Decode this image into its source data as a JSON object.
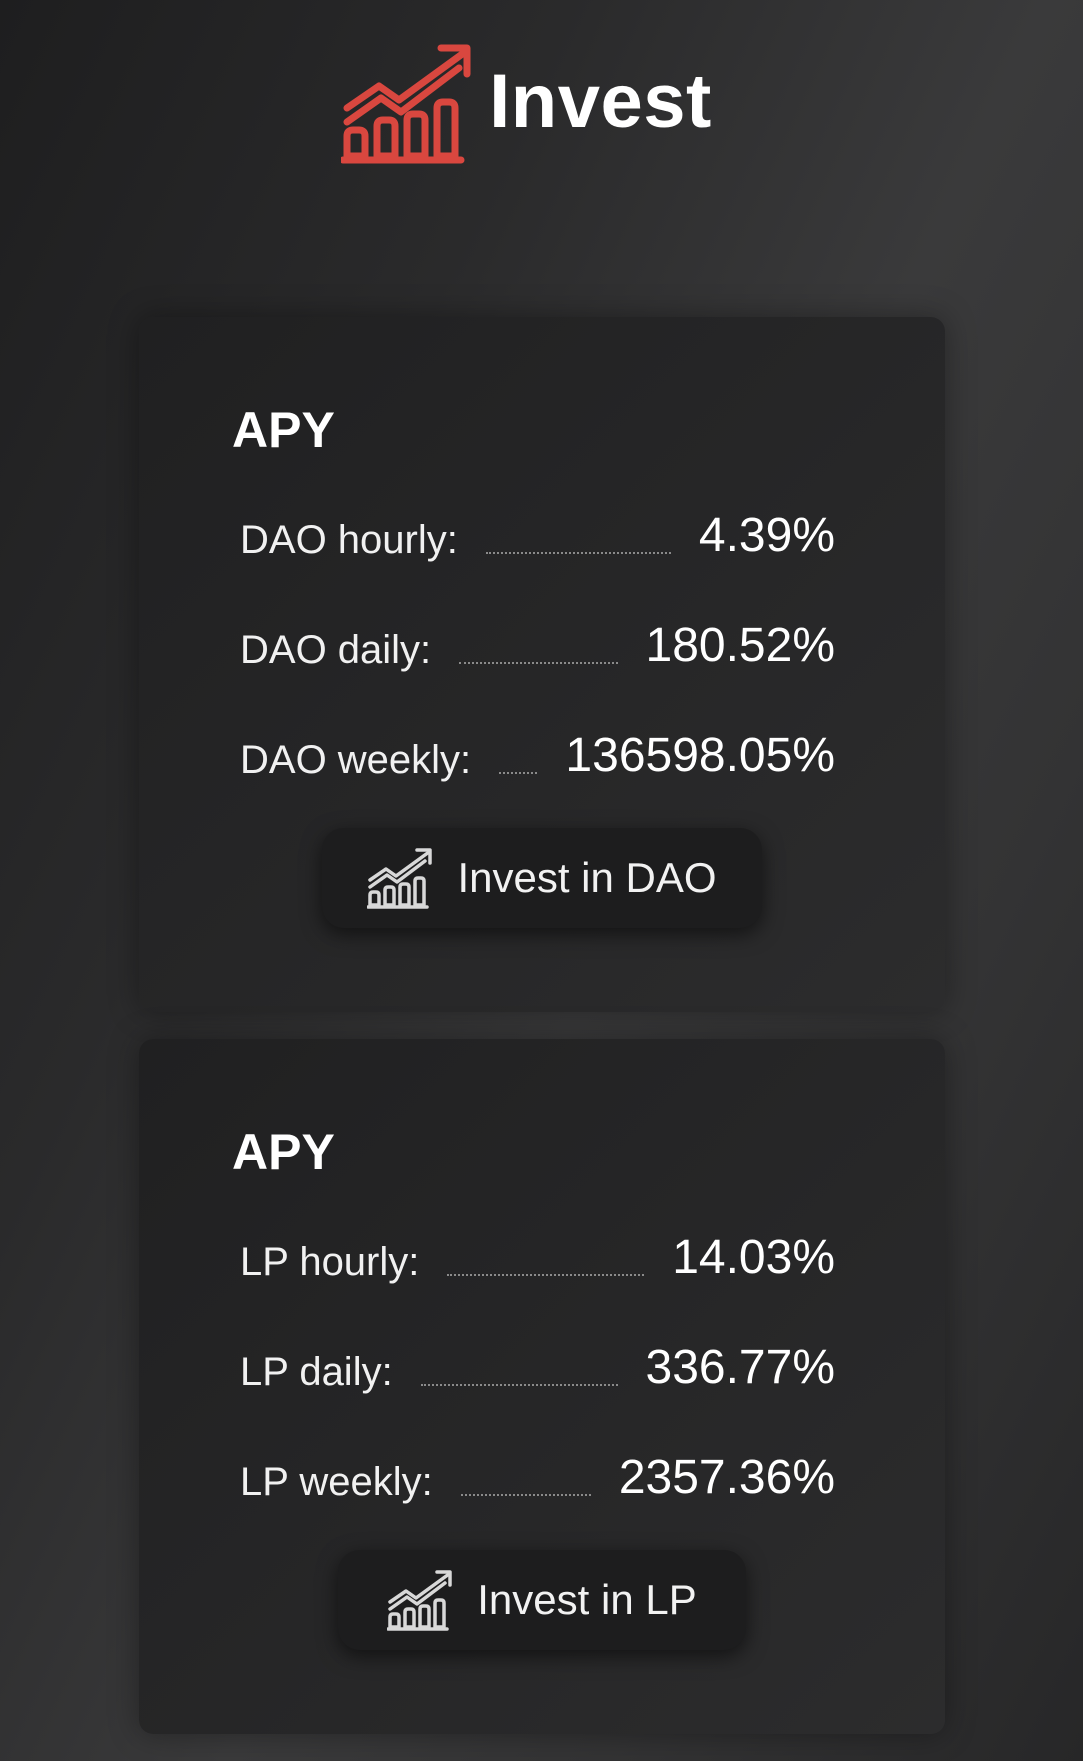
{
  "header": {
    "title": "Invest",
    "logo_icon": "growth-chart-icon",
    "accent_color": "#d9473f"
  },
  "cards": [
    {
      "heading": "APY",
      "rows": [
        {
          "label": "DAO hourly:",
          "value": "4.39%"
        },
        {
          "label": "DAO daily:",
          "value": "180.52%"
        },
        {
          "label": "DAO weekly:",
          "value": "136598.05%"
        }
      ],
      "button": {
        "label": "Invest in DAO",
        "icon": "growth-chart-icon"
      }
    },
    {
      "heading": "APY",
      "rows": [
        {
          "label": "LP hourly:",
          "value": "14.03%"
        },
        {
          "label": "LP daily:",
          "value": "336.77%"
        },
        {
          "label": "LP weekly:",
          "value": "2357.36%"
        }
      ],
      "button": {
        "label": "Invest in LP",
        "icon": "growth-chart-icon"
      }
    }
  ]
}
